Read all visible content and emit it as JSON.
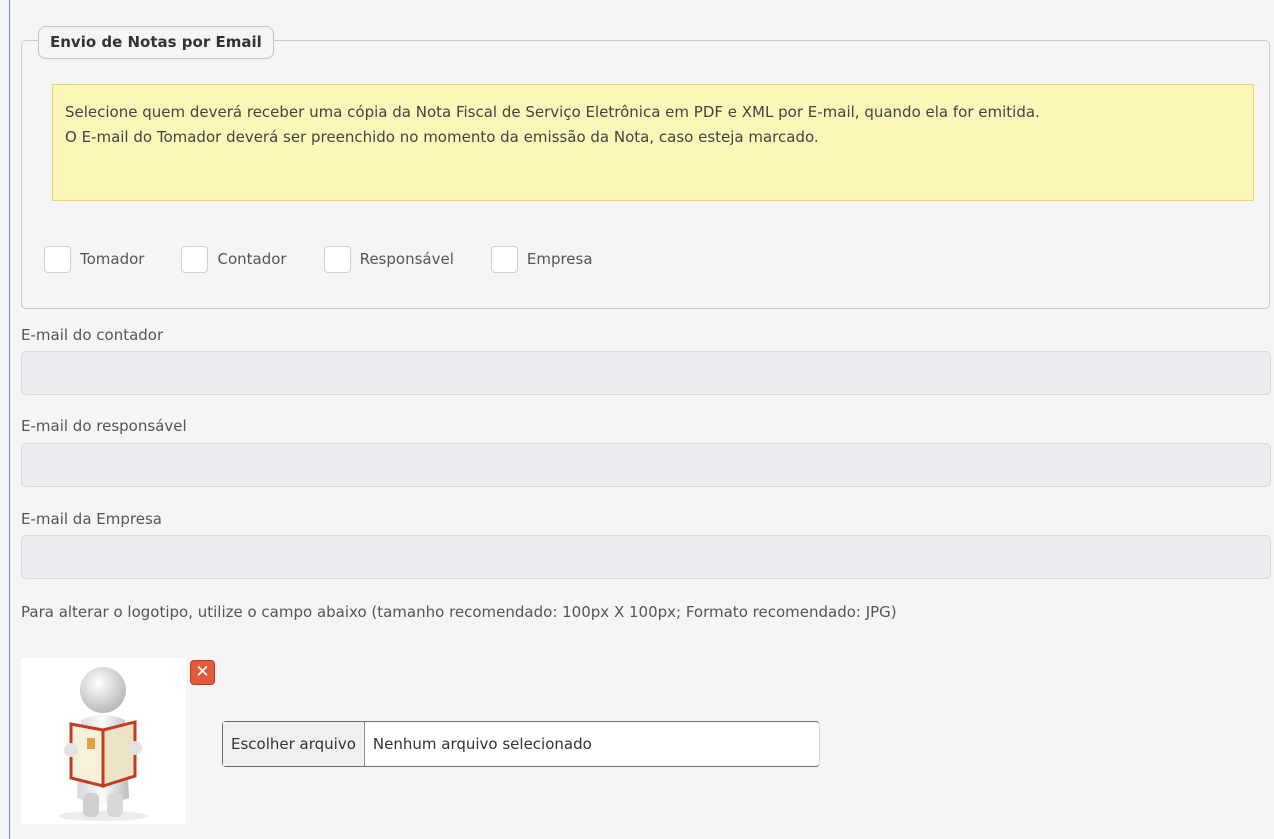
{
  "fieldset": {
    "legend": "Envio de Notas por Email",
    "notice_line1": "Selecione quem deverá receber uma cópia da Nota Fiscal de Serviço Eletrônica em PDF e XML por E-mail, quando ela for emitida.",
    "notice_line2": "O E-mail do Tomador deverá ser preenchido no momento da emissão da Nota, caso esteja marcado.",
    "checkboxes": [
      {
        "label": "Tomador",
        "checked": false
      },
      {
        "label": "Contador",
        "checked": false
      },
      {
        "label": "Responsável",
        "checked": false
      },
      {
        "label": "Empresa",
        "checked": false
      }
    ]
  },
  "fields": {
    "contador": {
      "label": "E-mail do contador",
      "value": ""
    },
    "responsavel": {
      "label": "E-mail do responsável",
      "value": ""
    },
    "empresa": {
      "label": "E-mail da Empresa",
      "value": ""
    }
  },
  "logo": {
    "hint": "Para alterar o logotipo, utilize o campo abaixo (tamanho recomendado: 100px X 100px; Formato recomendado: JPG)",
    "remove_icon": "close-icon",
    "file_button": "Escolher arquivo",
    "file_status": "Nenhum arquivo selecionado"
  },
  "colors": {
    "notice_bg": "#fcf6b8",
    "notice_border": "#f0d16f",
    "remove_button": "#e05a3c",
    "disabled_input": "#eaecef"
  }
}
